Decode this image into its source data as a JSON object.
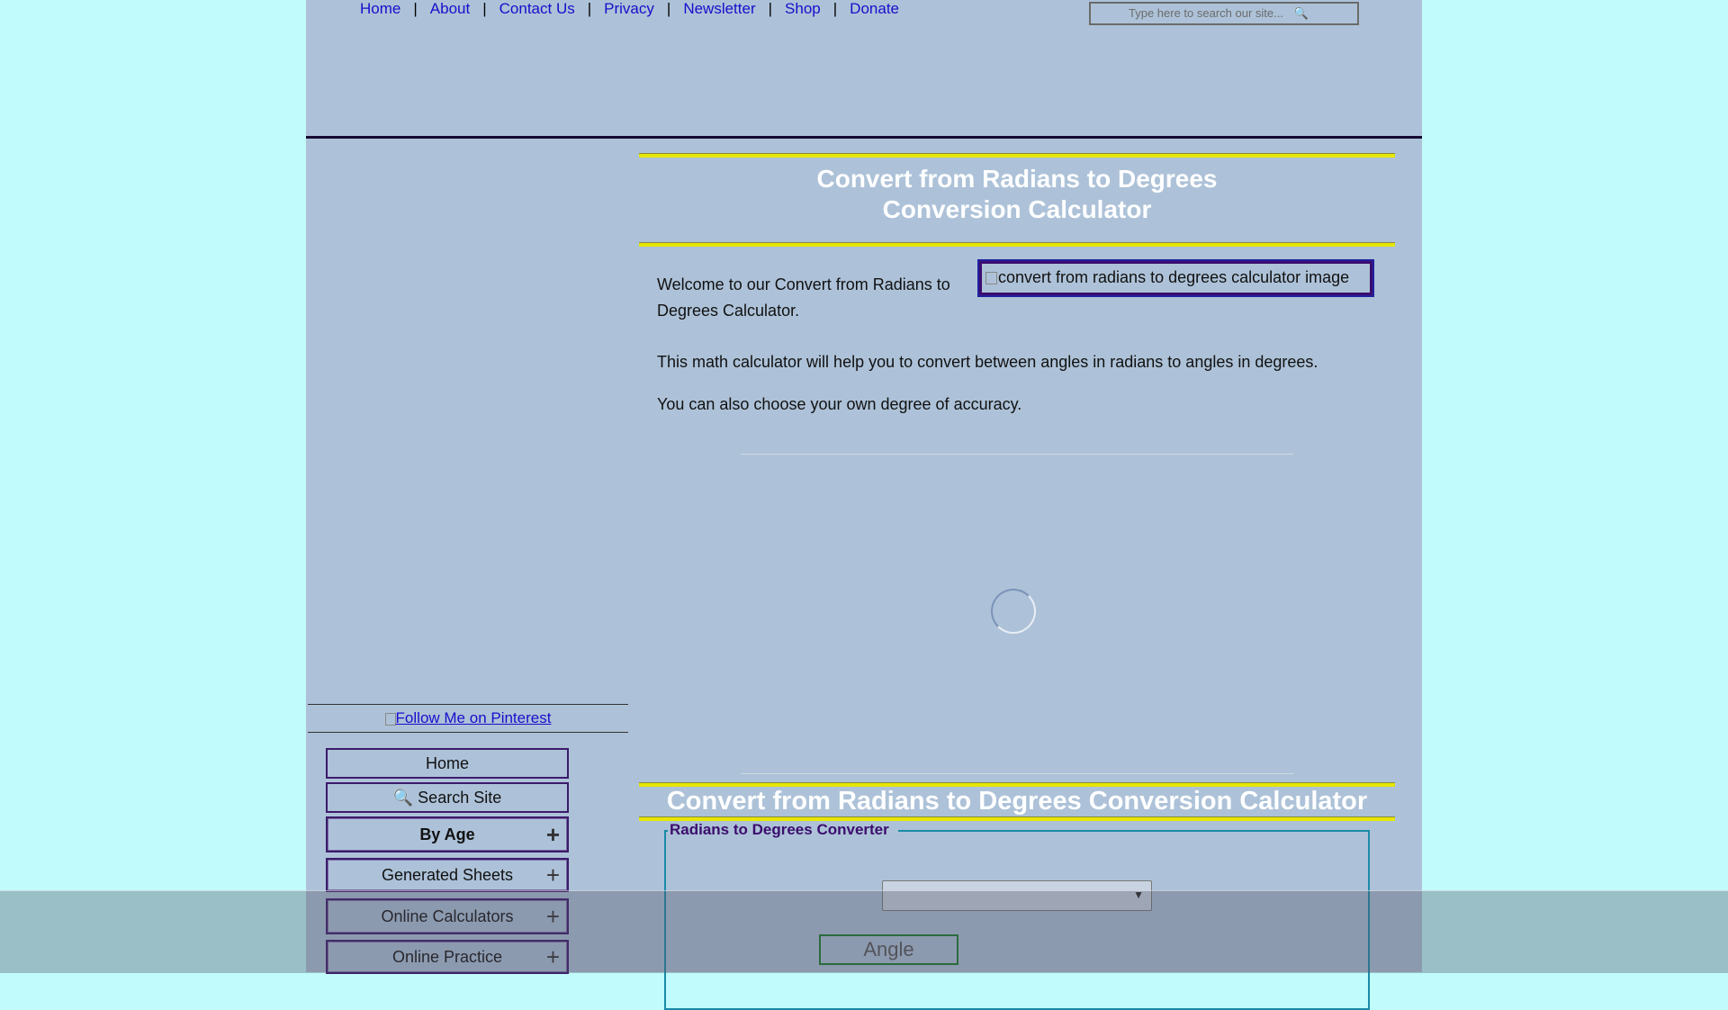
{
  "nav": {
    "links": [
      "Home",
      "About",
      "Contact Us",
      "Privacy",
      "Newsletter",
      "Shop",
      "Donate"
    ],
    "separator": "|",
    "search_placeholder": "Type here to search our site...",
    "search_icon": "magnifier-icon"
  },
  "page": {
    "title_line1": "Convert from Radians to Degrees",
    "title_line2": "Conversion Calculator",
    "welcome": "Welcome to our Convert from Radians to Degrees Calculator.",
    "hero_alt": "convert from radians to degrees calculator image",
    "para1": "This math calculator will help you to convert between angles in radians to angles in degrees.",
    "para2": "You can also choose your own degree of accuracy.",
    "section_title": "Convert from Radians to Degrees Conversion Calculator"
  },
  "converter": {
    "legend": "Radians to Degrees Converter",
    "select_value": "",
    "angle_button": "Angle"
  },
  "sidebar": {
    "pinterest": "Follow Me on Pinterest",
    "items": [
      {
        "label": "Home",
        "expandable": false,
        "bold": false
      },
      {
        "label": "🔍 Search Site",
        "expandable": false,
        "bold": false
      },
      {
        "label": "By Age",
        "expandable": true,
        "bold": true
      },
      {
        "label": "Generated Sheets",
        "expandable": true,
        "bold": false
      },
      {
        "label": "Online Calculators",
        "expandable": true,
        "bold": false
      },
      {
        "label": "Online Practice",
        "expandable": true,
        "bold": false
      }
    ],
    "expand_symbol": "+"
  },
  "colors": {
    "page_bg": "#adc2d8",
    "outer_bg": "#c2fbfb",
    "link": "#1a0dcc",
    "accent_rule": "#e6e600",
    "title_text": "#ffffff"
  }
}
